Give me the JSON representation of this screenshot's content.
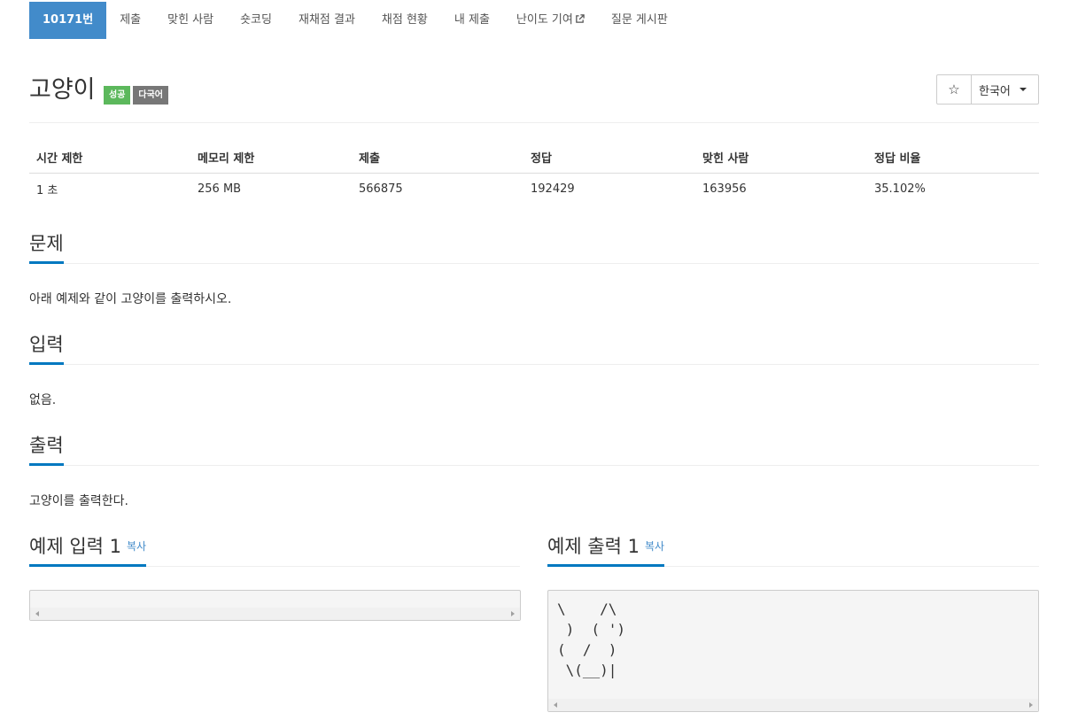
{
  "nav": {
    "tabs": [
      {
        "label": "10171번",
        "active": true
      },
      {
        "label": "제출"
      },
      {
        "label": "맞힌 사람"
      },
      {
        "label": "숏코딩"
      },
      {
        "label": "재채점 결과"
      },
      {
        "label": "채점 현황"
      },
      {
        "label": "내 제출"
      },
      {
        "label": "난이도 기여",
        "icon": "external-link-icon"
      },
      {
        "label": "질문 게시판"
      }
    ]
  },
  "problem": {
    "title": "고양이",
    "badge_success": "성공",
    "badge_multilang": "다국어",
    "star_icon": "☆",
    "language": "한국어"
  },
  "info_table": {
    "headers": [
      "시간 제한",
      "메모리 제한",
      "제출",
      "정답",
      "맞힌 사람",
      "정답 비율"
    ],
    "values": [
      "1 초",
      "256 MB",
      "566875",
      "192429",
      "163956",
      "35.102%"
    ]
  },
  "sections": {
    "description_title": "문제",
    "description_text": "아래 예제와 같이 고양이를 출력하시오.",
    "input_title": "입력",
    "input_text": "없음.",
    "output_title": "출력",
    "output_text": "고양이를 출력한다."
  },
  "samples": {
    "input_title": "예제 입력 1",
    "output_title": "예제 출력 1",
    "copy_label": "복사",
    "input_content": "",
    "output_content": "\\    /\\\n )  ( ')\n(  /  )\n \\(__)|"
  },
  "colors": {
    "accent": "#428bca",
    "section_underline": "#0078c0",
    "success": "#5cb85c",
    "gray_badge": "#777777"
  }
}
